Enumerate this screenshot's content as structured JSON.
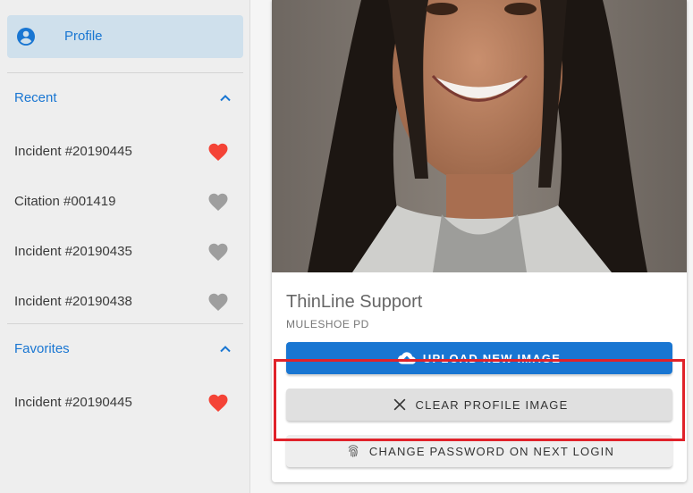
{
  "sidebar": {
    "profile_label": "Profile",
    "recent": {
      "title": "Recent",
      "items": [
        {
          "label": "Incident #20190445",
          "favorited": true
        },
        {
          "label": "Citation #001419",
          "favorited": false
        },
        {
          "label": "Incident #20190435",
          "favorited": false
        },
        {
          "label": "Incident #20190438",
          "favorited": false
        }
      ]
    },
    "favorites": {
      "title": "Favorites",
      "items": [
        {
          "label": "Incident #20190445",
          "favorited": true
        }
      ]
    }
  },
  "profile": {
    "name": "ThinLine Support",
    "department": "MULESHOE PD",
    "buttons": {
      "upload": "UPLOAD NEW IMAGE",
      "clear": "CLEAR PROFILE IMAGE",
      "change_password": "CHANGE PASSWORD ON NEXT LOGIN"
    }
  },
  "colors": {
    "accent": "#1976d2",
    "heart_active": "#f44336",
    "heart_inactive": "#9e9e9e",
    "highlight": "#e0222a"
  }
}
